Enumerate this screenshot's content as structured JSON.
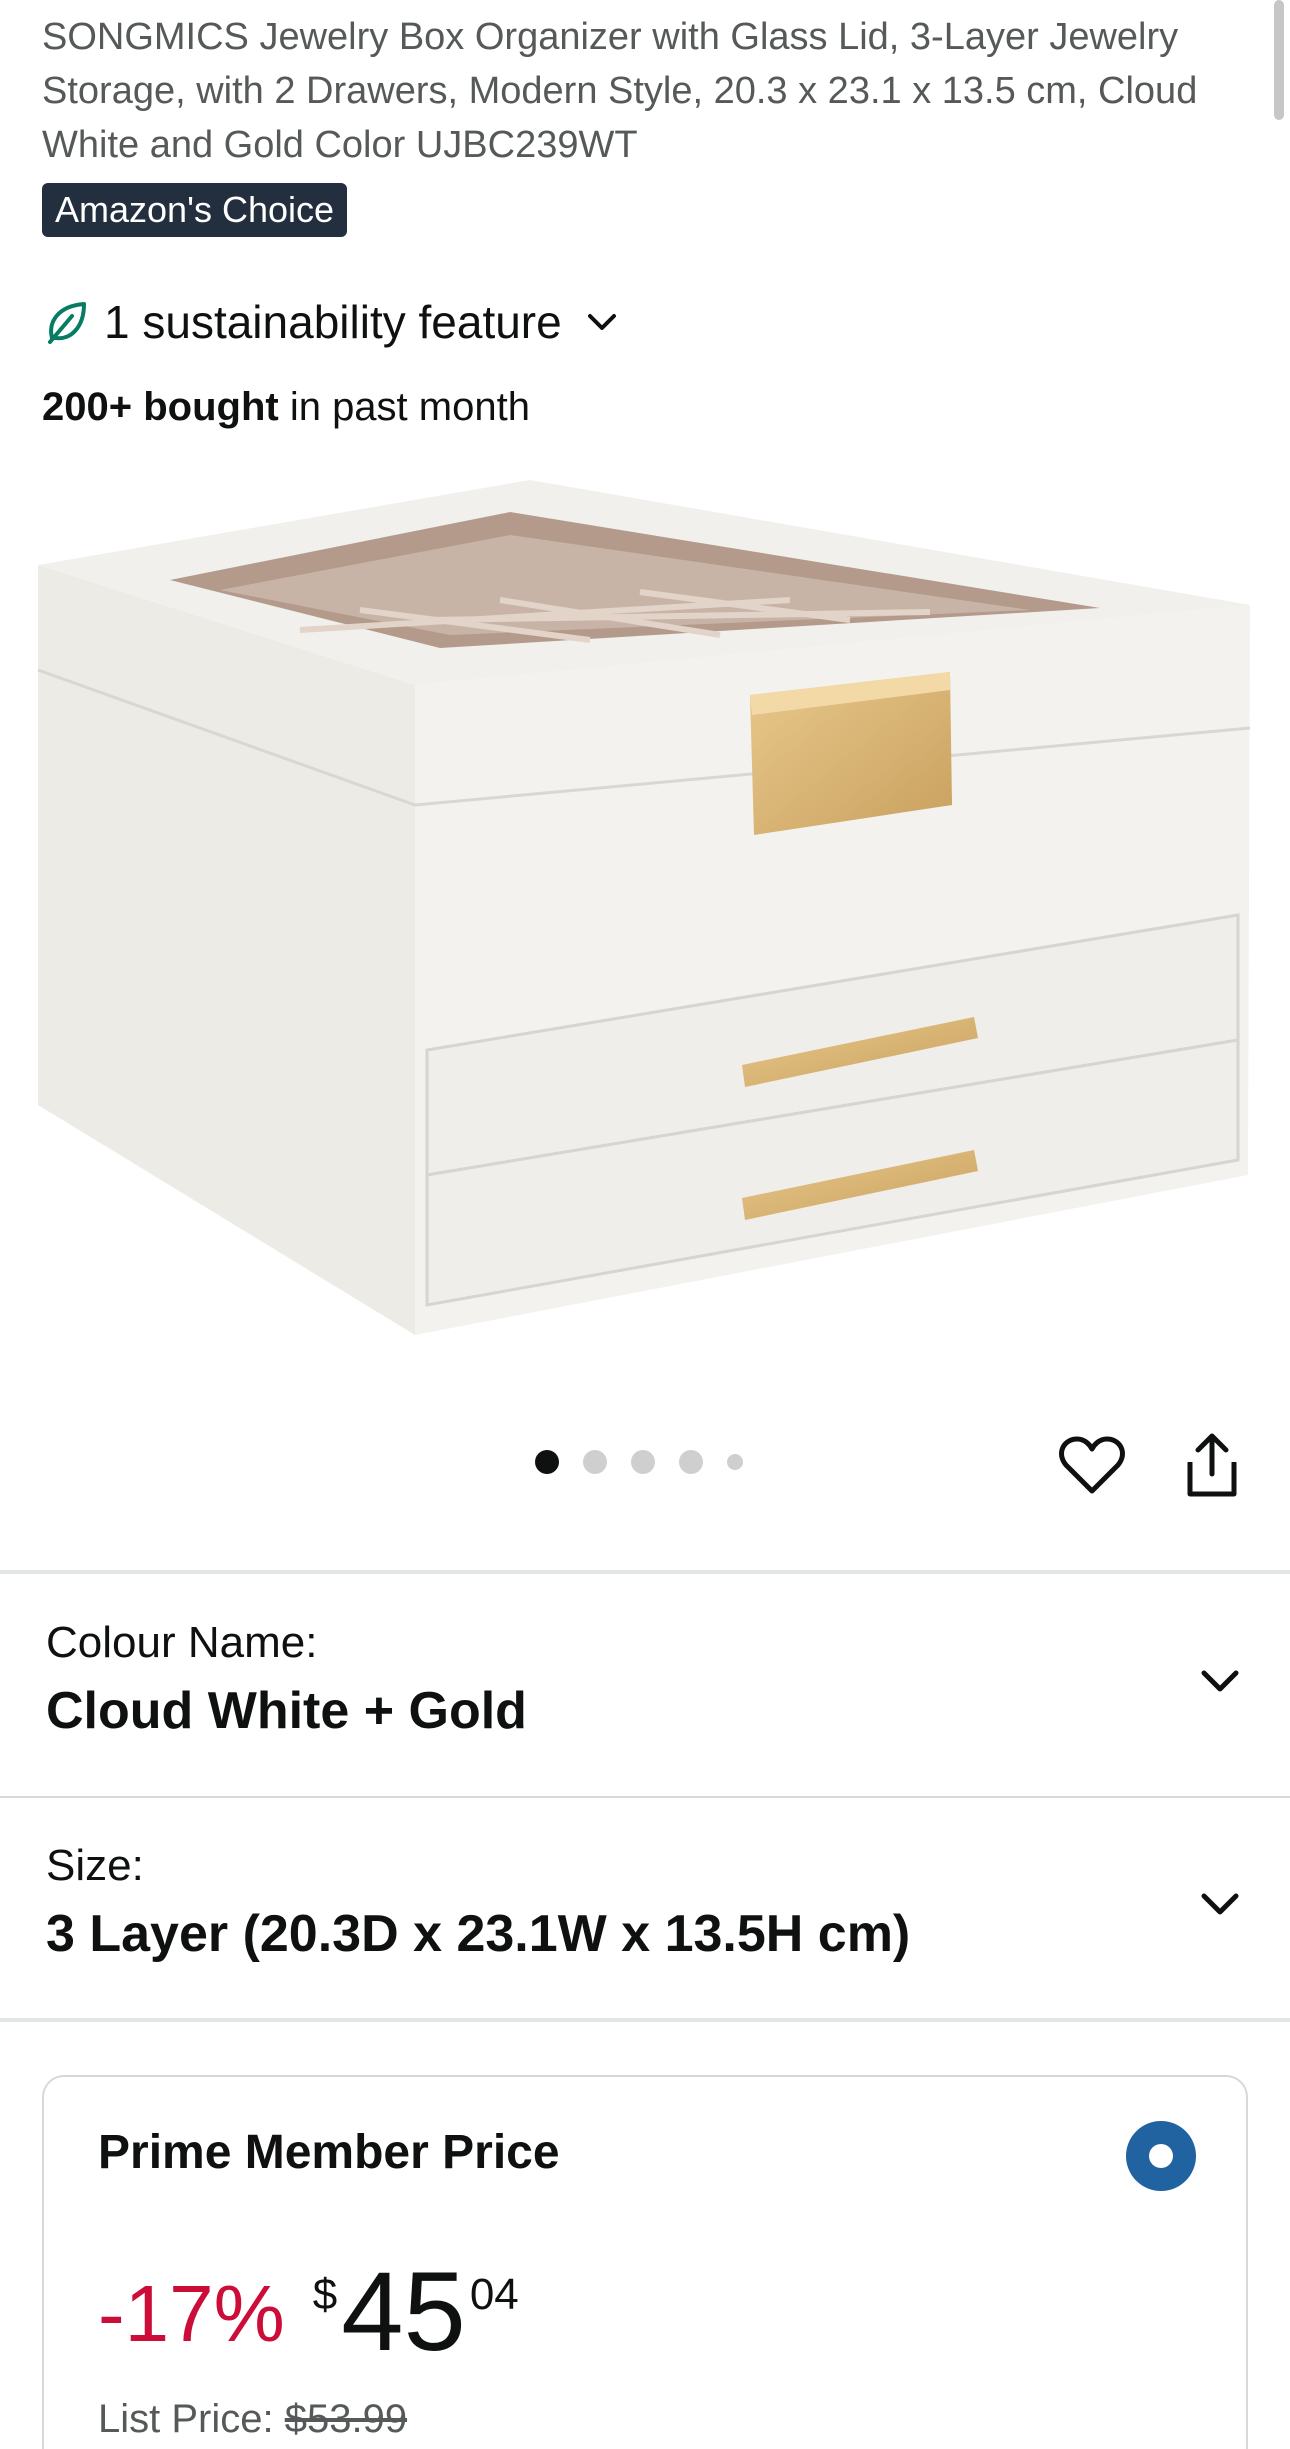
{
  "product": {
    "title": "SONGMICS Jewelry Box Organizer with Glass Lid, 3-Layer Jewelry Storage, with 2 Drawers, Modern Style, 20.3 x 23.1 x 13.5 cm, Cloud White and Gold Color UJBC239WT",
    "badge": "Amazon's Choice",
    "sustainability": "1 sustainability feature",
    "bought_bold": "200+ bought",
    "bought_rest": " in past month"
  },
  "gallery": {
    "image_count": 5,
    "active_index": 0
  },
  "variations": {
    "colour_label": "Colour Name:",
    "colour_value": "Cloud White + Gold",
    "size_label": "Size:",
    "size_value": "3 Layer (20.3D x 23.1W x 13.5H cm)"
  },
  "pricing": {
    "heading": "Prime Member Price",
    "discount": "-17%",
    "currency": "$",
    "whole": "45",
    "fraction": "04",
    "list_label": "List Price: ",
    "list_value": "$53.99"
  },
  "colors": {
    "badge_bg": "#232f3e",
    "discount": "#cc0c39",
    "radio": "#2162a1",
    "leaf": "#067d62"
  },
  "icons": {
    "sustainability": "leaf-icon",
    "wishlist": "heart-icon",
    "share": "share-icon",
    "expand": "chevron-down-icon"
  }
}
